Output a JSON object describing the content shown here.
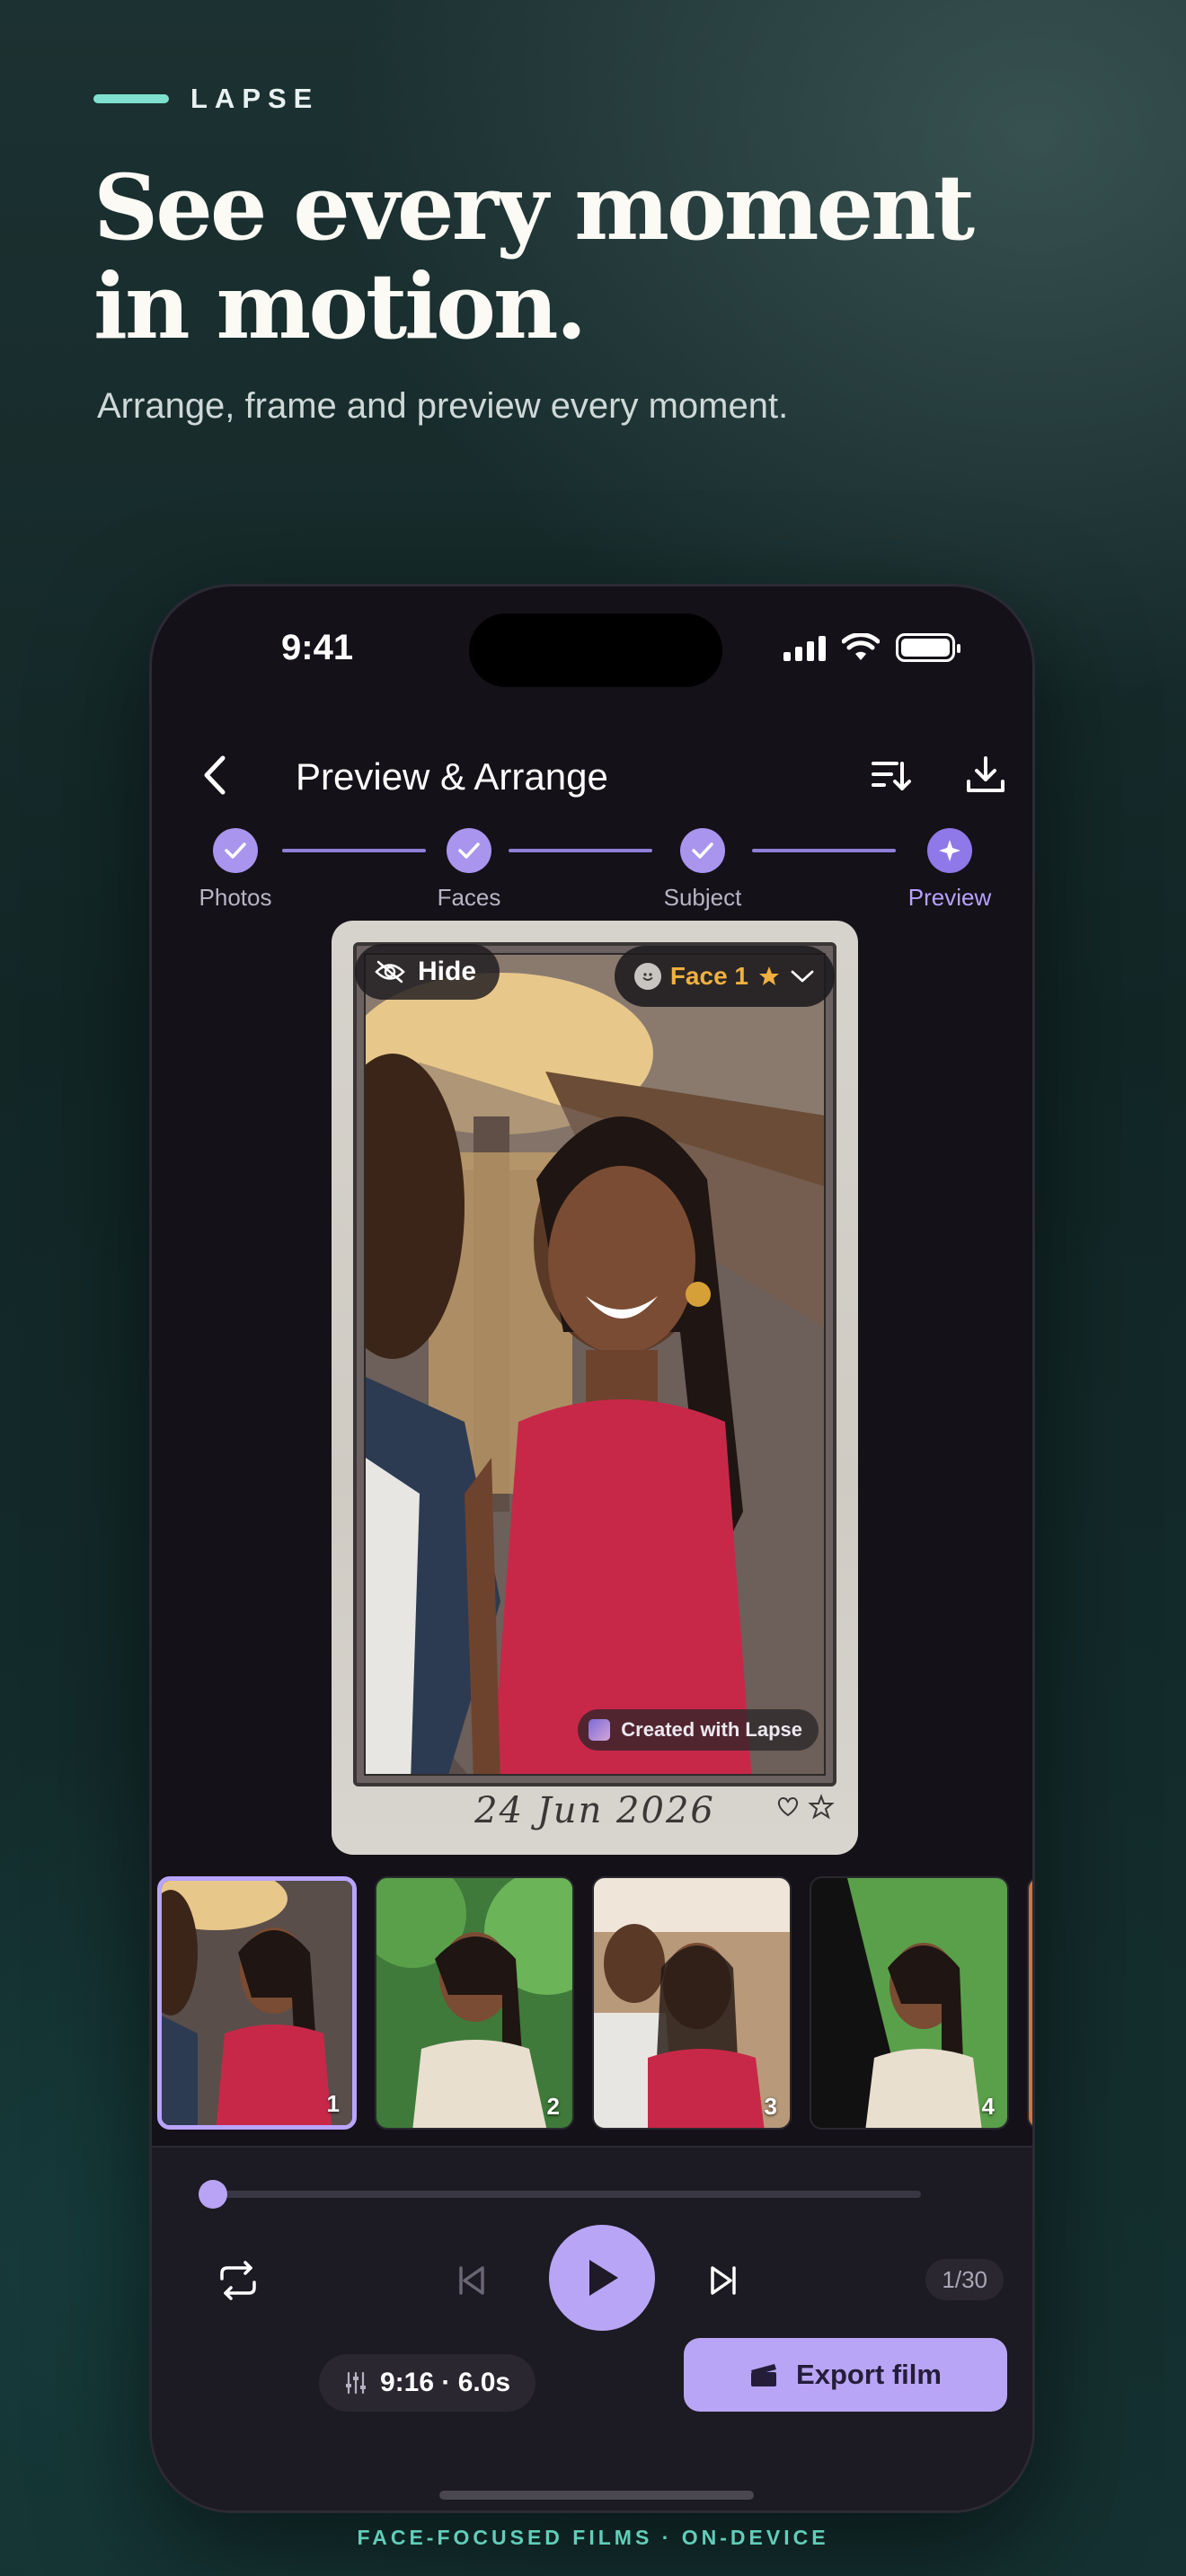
{
  "brand": {
    "name": "LAPSE"
  },
  "hero": {
    "headline_line1": "See every moment",
    "headline_line2": "in motion.",
    "subline": "Arrange, frame and preview every moment."
  },
  "status_bar": {
    "time": "9:41"
  },
  "nav": {
    "title": "Preview & Arrange",
    "back_icon": "chevron-left-icon",
    "sort_icon": "sort-icon",
    "download_icon": "download-icon"
  },
  "steps": [
    {
      "label": "Photos",
      "state": "done"
    },
    {
      "label": "Faces",
      "state": "done"
    },
    {
      "label": "Subject",
      "state": "done"
    },
    {
      "label": "Preview",
      "state": "active"
    }
  ],
  "preview": {
    "hide_label": "Hide",
    "face_label": "Face 1",
    "watermark": "Created with Lapse",
    "date": "24 Jun 2026"
  },
  "thumbnails": [
    {
      "number": "1",
      "selected": true
    },
    {
      "number": "2",
      "selected": false
    },
    {
      "number": "3",
      "selected": false
    },
    {
      "number": "4",
      "selected": false
    }
  ],
  "player": {
    "progress": 0,
    "counter": "1/30",
    "format": "9:16 · 6.0s",
    "export_label": "Export film"
  },
  "colors": {
    "accent": "#b9a5f5",
    "footer": "#62cdb9",
    "face_label": "#f0b040"
  },
  "footer": {
    "tagline": "FACE-FOCUSED FILMS · ON-DEVICE"
  }
}
